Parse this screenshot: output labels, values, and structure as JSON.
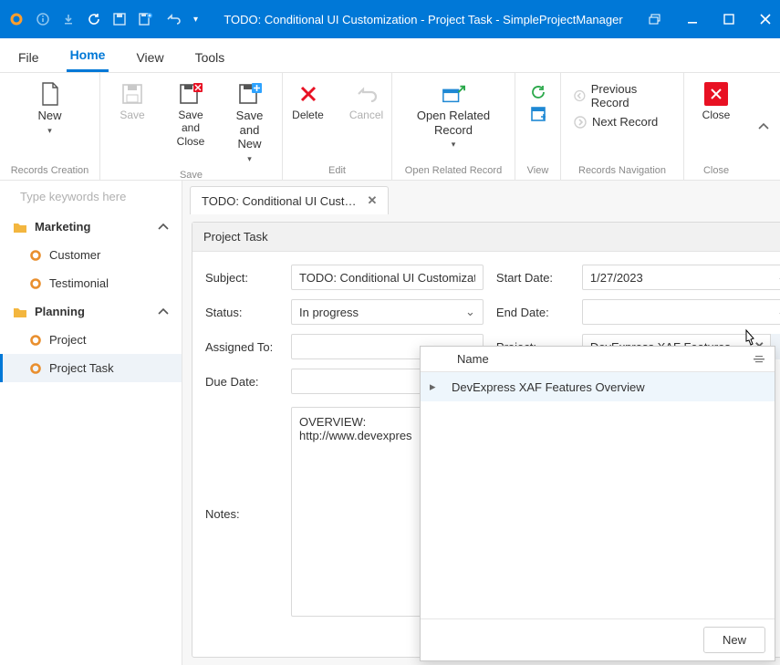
{
  "window": {
    "title": "TODO: Conditional UI Customization - Project Task - SimpleProjectManager"
  },
  "menubar": {
    "file": "File",
    "home": "Home",
    "view": "View",
    "tools": "Tools"
  },
  "ribbon": {
    "new": "New",
    "save": "Save",
    "save_close": "Save and\nClose",
    "save_new": "Save and New",
    "delete": "Delete",
    "cancel": "Cancel",
    "open_related": "Open Related\nRecord",
    "prev_record": "Previous Record",
    "next_record": "Next Record",
    "close": "Close",
    "group_records_creation": "Records Creation",
    "group_save": "Save",
    "group_edit": "Edit",
    "group_open_related": "Open Related Record",
    "group_view": "View",
    "group_records_nav": "Records Navigation",
    "group_close": "Close"
  },
  "sidebar": {
    "search_placeholder": "Type keywords here",
    "groups": [
      {
        "label": "Marketing",
        "items": [
          "Customer",
          "Testimonial"
        ]
      },
      {
        "label": "Planning",
        "items": [
          "Project",
          "Project Task"
        ]
      }
    ]
  },
  "tab": {
    "label": "TODO: Conditional UI Cust…"
  },
  "card": {
    "header": "Project Task"
  },
  "form": {
    "subject_label": "Subject:",
    "subject_value": "TODO: Conditional UI Customization",
    "status_label": "Status:",
    "status_value": "In progress",
    "assigned_label": "Assigned To:",
    "assigned_value": "",
    "duedate_label": "Due Date:",
    "duedate_value": "",
    "startdate_label": "Start Date:",
    "startdate_value": "1/27/2023",
    "enddate_label": "End Date:",
    "enddate_value": "",
    "project_label": "Project:",
    "project_value": "DevExpress XAF Features Overvi…",
    "notes_label": "Notes:",
    "notes_value": "OVERVIEW: http://www.devexpres"
  },
  "popup": {
    "col_name": "Name",
    "row0": "DevExpress XAF Features Overview",
    "new_button": "New"
  }
}
